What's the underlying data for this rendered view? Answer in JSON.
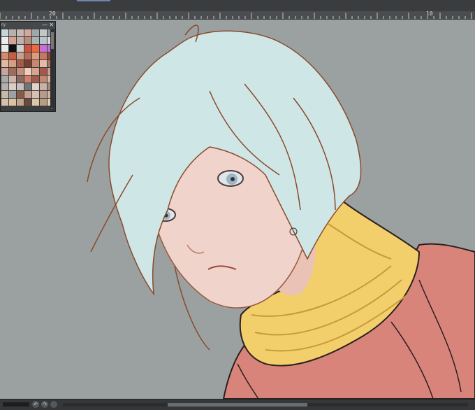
{
  "ruler": {
    "labels": [
      "20",
      "10"
    ]
  },
  "palette": {
    "title": "ry",
    "minimize": "—",
    "close": "✕",
    "scroll_arrow": "⌄",
    "swatches": [
      "#c9d4d6",
      "#b9b1ab",
      "#c8b9b0",
      "#d4a79a",
      "#9fa8a6",
      "#c2c8c8",
      "#8c9aa0",
      "#ececec",
      "#d3a495",
      "#c5b0a8",
      "#b68e7e",
      "#a9b2ae",
      "#b8c6c9",
      "#d9d9d9",
      "#e8e8e8",
      "#101010",
      "#d0cfcf",
      "#d2503c",
      "#ed6a3e",
      "#c870d5",
      "#b774d8",
      "#d48a6c",
      "#c65c43",
      "#c9a18b",
      "#b86a54",
      "#de9a7b",
      "#c7785e",
      "#8c4c3c",
      "#e6b79f",
      "#d89c80",
      "#a65c44",
      "#7b3e2f",
      "#c68872",
      "#e3bba7",
      "#b0735c",
      "#caa39a",
      "#9f6c5c",
      "#c98e7a",
      "#f2ccb8",
      "#d6a58e",
      "#a8554a",
      "#c8a28c",
      "#a7a9a9",
      "#d0b2a6",
      "#8a6a60",
      "#d17f68",
      "#9e5b4c",
      "#c1876f",
      "#e0b8a1",
      "#b5b0ac",
      "#d9cdc6",
      "#c9bfb9",
      "#737475",
      "#e2d2c5",
      "#c9b2a5",
      "#a48c80",
      "#cbb9a8",
      "#9aa2a5",
      "#8a5a46",
      "#c4a090",
      "#d6c0b0",
      "#b79a8a",
      "#cdb59e",
      "#d7c0a8",
      "#d9c3a1",
      "#c2a48a",
      "#6a4a3c",
      "#dcc6a9",
      "#b99d7c",
      "#e0cfb0"
    ]
  },
  "status": {
    "undo": "↶",
    "redo": "↷"
  },
  "colors": {
    "canvas": "#9ba1a0",
    "hair": "#cfe6e6",
    "skin": "#f0d3cb",
    "scarf": "#f2cf6a",
    "jacket": "#d9847a",
    "line": "#8a4a2c"
  }
}
